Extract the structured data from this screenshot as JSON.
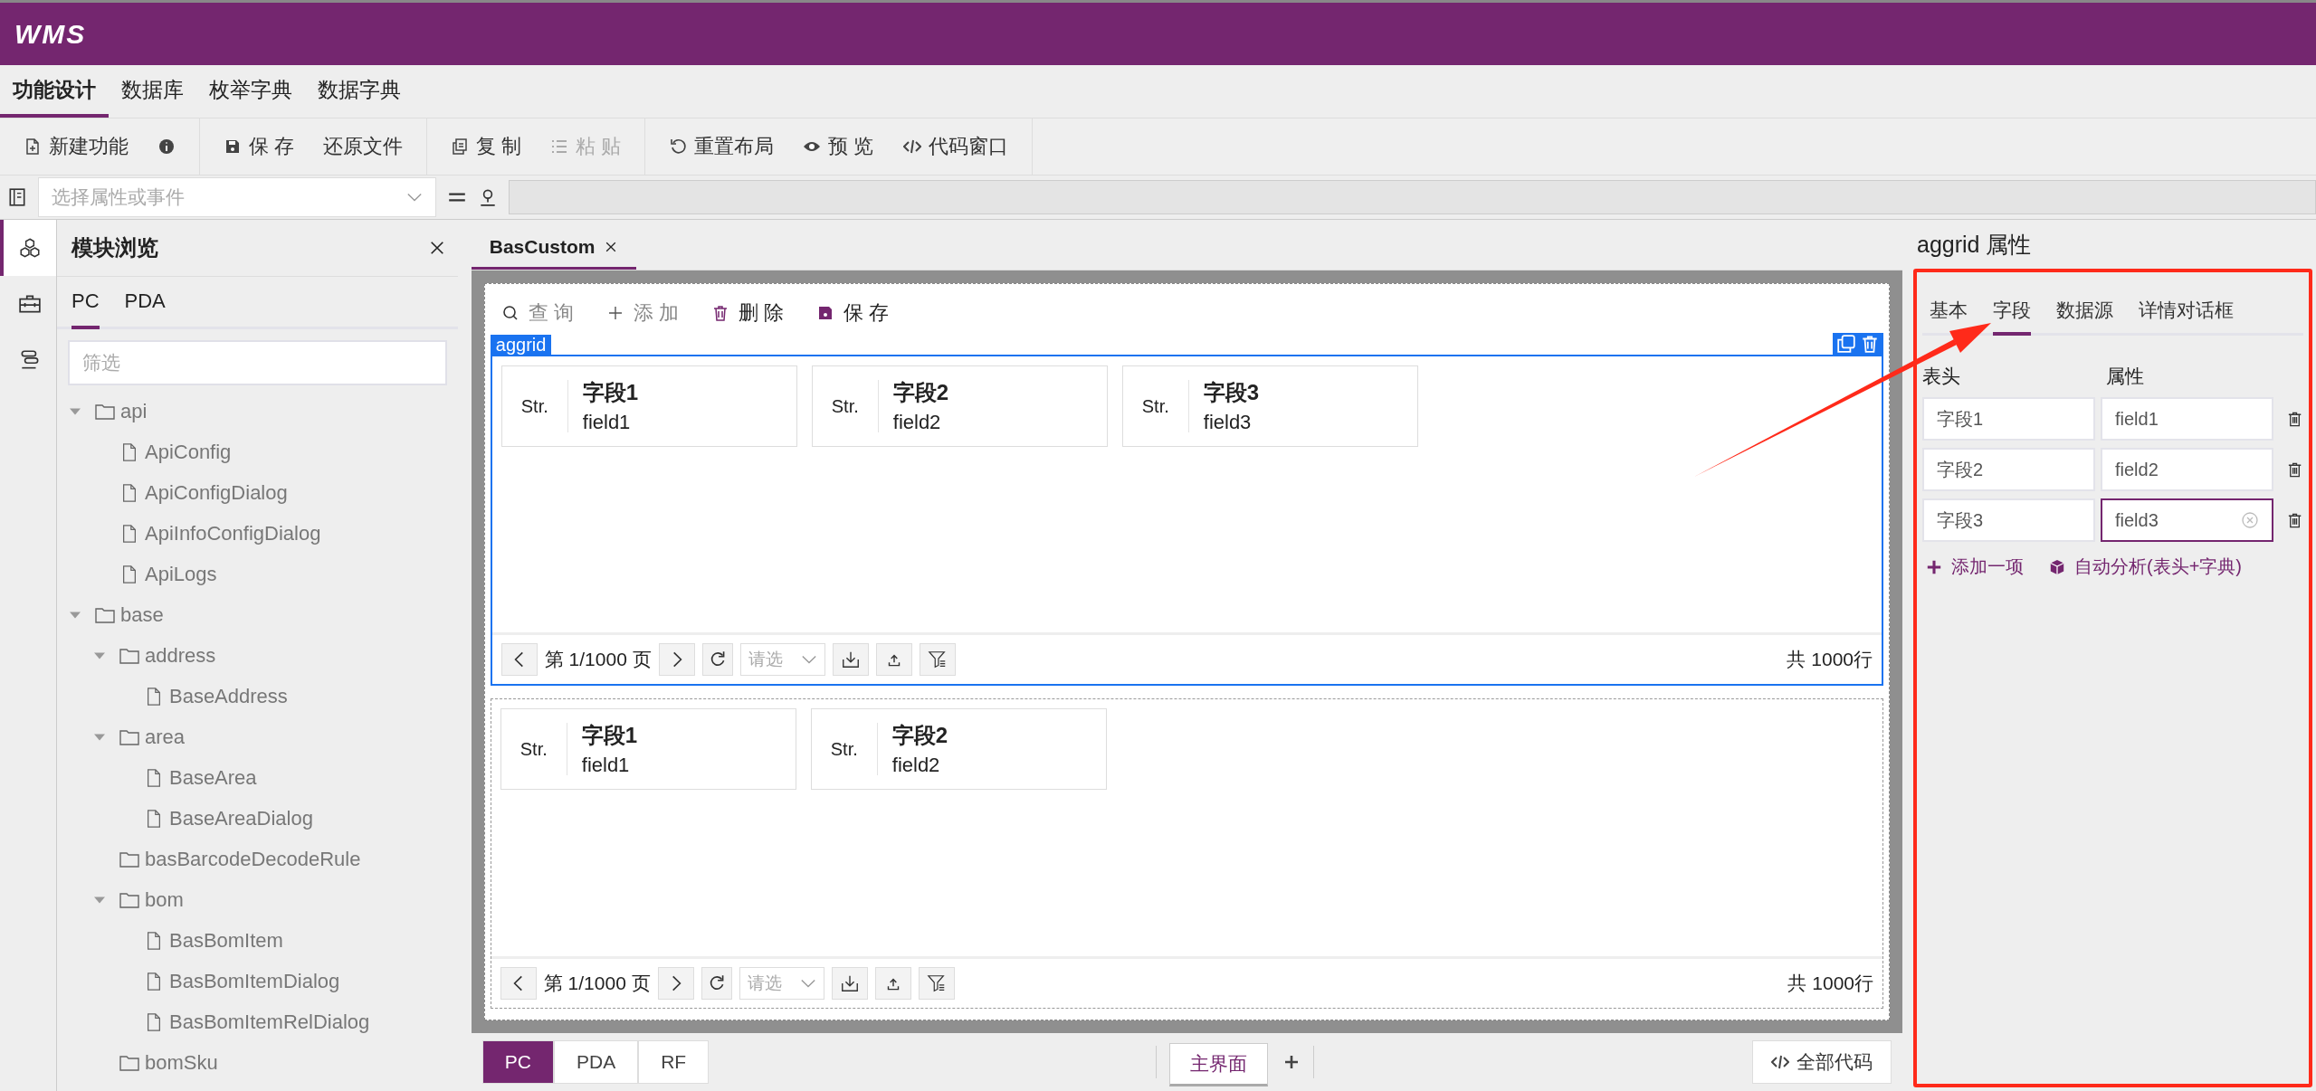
{
  "app": {
    "logo": "WMS"
  },
  "menu_tabs": [
    {
      "label": "功能设计",
      "selected": true
    },
    {
      "label": "数据库",
      "selected": false
    },
    {
      "label": "枚举字典",
      "selected": false
    },
    {
      "label": "数据字典",
      "selected": false
    }
  ],
  "toolbar_groups": [
    {
      "items": [
        {
          "label": "新建功能",
          "disabled": false
        },
        {
          "disabled": false
        }
      ]
    },
    {
      "items": [
        {
          "label": "保 存",
          "disabled": false
        },
        {
          "label": "还原文件",
          "disabled": false
        }
      ]
    },
    {
      "items": [
        {
          "label": "复 制",
          "disabled": false
        },
        {
          "label": "粘 贴",
          "disabled": true
        }
      ]
    },
    {
      "items": [
        {
          "label": "重置布局",
          "disabled": false
        },
        {
          "label": "预 览",
          "disabled": false
        },
        {
          "label": "代码窗口",
          "disabled": false
        }
      ]
    }
  ],
  "property_select": {
    "placeholder": "选择属性或事件"
  },
  "rail": [
    {
      "selected": true
    },
    {
      "selected": false
    },
    {
      "selected": false
    }
  ],
  "sidebar": {
    "title": "模块浏览",
    "tabs": [
      {
        "label": "PC",
        "selected": true
      },
      {
        "label": "PDA",
        "selected": false
      }
    ],
    "filter": {
      "placeholder": "筛选"
    },
    "tree": [
      {
        "kind": "folder",
        "label": "api",
        "children": [
          {
            "kind": "file",
            "label": "ApiConfig"
          },
          {
            "kind": "file",
            "label": "ApiConfigDialog"
          },
          {
            "kind": "file",
            "label": "ApiInfoConfigDialog"
          },
          {
            "kind": "file",
            "label": "ApiLogs"
          }
        ]
      },
      {
        "kind": "folder",
        "label": "base",
        "children": [
          {
            "kind": "folder",
            "label": "address",
            "children": [
              {
                "kind": "file",
                "label": "BaseAddress"
              }
            ]
          },
          {
            "kind": "folder",
            "label": "area",
            "children": [
              {
                "kind": "file",
                "label": "BaseArea"
              },
              {
                "kind": "file",
                "label": "BaseAreaDialog"
              }
            ]
          },
          {
            "kind": "folder",
            "label": "basBarcodeDecodeRule"
          },
          {
            "kind": "folder",
            "label": "bom",
            "children": [
              {
                "kind": "file",
                "label": "BasBomItem"
              },
              {
                "kind": "file",
                "label": "BasBomItemDialog"
              },
              {
                "kind": "file",
                "label": "BasBomItemRelDialog"
              }
            ]
          },
          {
            "kind": "folder",
            "label": "bomSku"
          }
        ]
      }
    ]
  },
  "editor_tabs": [
    {
      "label": "BasCustom",
      "selected": true
    }
  ],
  "canvas_toolbar": [
    {
      "label": "查 询",
      "disabled": true
    },
    {
      "label": "添 加",
      "disabled": true
    },
    {
      "label": "删 除",
      "disabled": false
    },
    {
      "label": "保 存",
      "disabled": false
    }
  ],
  "grids": [
    {
      "selected": true,
      "label": "aggrid",
      "columns": [
        {
          "type": "Str.",
          "title": "字段1",
          "field": "field1"
        },
        {
          "type": "Str.",
          "title": "字段2",
          "field": "field2"
        },
        {
          "type": "Str.",
          "title": "字段3",
          "field": "field3"
        }
      ],
      "pager": {
        "page": "第 1/1000 页",
        "size_placeholder": "请选",
        "total": "共 1000行"
      }
    },
    {
      "selected": false,
      "columns": [
        {
          "type": "Str.",
          "title": "字段1",
          "field": "field1"
        },
        {
          "type": "Str.",
          "title": "字段2",
          "field": "field2"
        }
      ],
      "pager": {
        "page": "第 1/1000 页",
        "size_placeholder": "请选",
        "total": "共 1000行"
      }
    }
  ],
  "platform_tabs": [
    {
      "label": "PC",
      "selected": true
    },
    {
      "label": "PDA",
      "selected": false
    },
    {
      "label": "RF",
      "selected": false
    }
  ],
  "page_tabs": [
    {
      "label": "主界面",
      "selected": true
    }
  ],
  "code_button": "全部代码",
  "properties": {
    "title": "aggrid 属性",
    "tabs": [
      {
        "label": "基本",
        "selected": false
      },
      {
        "label": "字段",
        "selected": true
      },
      {
        "label": "数据源",
        "selected": false
      },
      {
        "label": "详情对话框",
        "selected": false
      }
    ],
    "columns": [
      "表头",
      "属性"
    ],
    "rows": [
      {
        "header": "字段1",
        "field": "field1",
        "focused": false
      },
      {
        "header": "字段2",
        "field": "field2",
        "focused": false
      },
      {
        "header": "字段3",
        "field": "field3",
        "focused": true
      }
    ],
    "actions": [
      "添加一项",
      "自动分析(表头+字典)"
    ]
  }
}
